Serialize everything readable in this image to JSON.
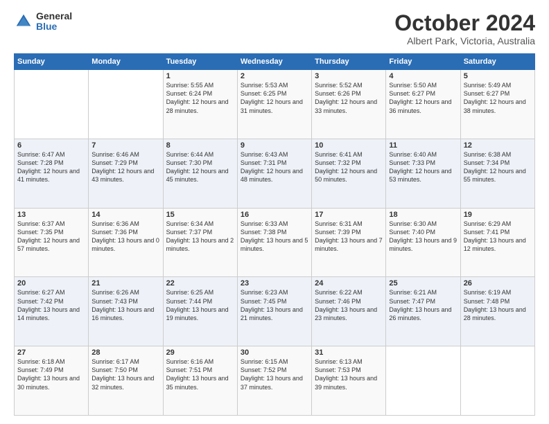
{
  "logo": {
    "general": "General",
    "blue": "Blue"
  },
  "title": "October 2024",
  "subtitle": "Albert Park, Victoria, Australia",
  "days_header": [
    "Sunday",
    "Monday",
    "Tuesday",
    "Wednesday",
    "Thursday",
    "Friday",
    "Saturday"
  ],
  "weeks": [
    [
      {
        "day": "",
        "sunrise": "",
        "sunset": "",
        "daylight": ""
      },
      {
        "day": "",
        "sunrise": "",
        "sunset": "",
        "daylight": ""
      },
      {
        "day": "1",
        "sunrise": "Sunrise: 5:55 AM",
        "sunset": "Sunset: 6:24 PM",
        "daylight": "Daylight: 12 hours and 28 minutes."
      },
      {
        "day": "2",
        "sunrise": "Sunrise: 5:53 AM",
        "sunset": "Sunset: 6:25 PM",
        "daylight": "Daylight: 12 hours and 31 minutes."
      },
      {
        "day": "3",
        "sunrise": "Sunrise: 5:52 AM",
        "sunset": "Sunset: 6:26 PM",
        "daylight": "Daylight: 12 hours and 33 minutes."
      },
      {
        "day": "4",
        "sunrise": "Sunrise: 5:50 AM",
        "sunset": "Sunset: 6:27 PM",
        "daylight": "Daylight: 12 hours and 36 minutes."
      },
      {
        "day": "5",
        "sunrise": "Sunrise: 5:49 AM",
        "sunset": "Sunset: 6:27 PM",
        "daylight": "Daylight: 12 hours and 38 minutes."
      }
    ],
    [
      {
        "day": "6",
        "sunrise": "Sunrise: 6:47 AM",
        "sunset": "Sunset: 7:28 PM",
        "daylight": "Daylight: 12 hours and 41 minutes."
      },
      {
        "day": "7",
        "sunrise": "Sunrise: 6:46 AM",
        "sunset": "Sunset: 7:29 PM",
        "daylight": "Daylight: 12 hours and 43 minutes."
      },
      {
        "day": "8",
        "sunrise": "Sunrise: 6:44 AM",
        "sunset": "Sunset: 7:30 PM",
        "daylight": "Daylight: 12 hours and 45 minutes."
      },
      {
        "day": "9",
        "sunrise": "Sunrise: 6:43 AM",
        "sunset": "Sunset: 7:31 PM",
        "daylight": "Daylight: 12 hours and 48 minutes."
      },
      {
        "day": "10",
        "sunrise": "Sunrise: 6:41 AM",
        "sunset": "Sunset: 7:32 PM",
        "daylight": "Daylight: 12 hours and 50 minutes."
      },
      {
        "day": "11",
        "sunrise": "Sunrise: 6:40 AM",
        "sunset": "Sunset: 7:33 PM",
        "daylight": "Daylight: 12 hours and 53 minutes."
      },
      {
        "day": "12",
        "sunrise": "Sunrise: 6:38 AM",
        "sunset": "Sunset: 7:34 PM",
        "daylight": "Daylight: 12 hours and 55 minutes."
      }
    ],
    [
      {
        "day": "13",
        "sunrise": "Sunrise: 6:37 AM",
        "sunset": "Sunset: 7:35 PM",
        "daylight": "Daylight: 12 hours and 57 minutes."
      },
      {
        "day": "14",
        "sunrise": "Sunrise: 6:36 AM",
        "sunset": "Sunset: 7:36 PM",
        "daylight": "Daylight: 13 hours and 0 minutes."
      },
      {
        "day": "15",
        "sunrise": "Sunrise: 6:34 AM",
        "sunset": "Sunset: 7:37 PM",
        "daylight": "Daylight: 13 hours and 2 minutes."
      },
      {
        "day": "16",
        "sunrise": "Sunrise: 6:33 AM",
        "sunset": "Sunset: 7:38 PM",
        "daylight": "Daylight: 13 hours and 5 minutes."
      },
      {
        "day": "17",
        "sunrise": "Sunrise: 6:31 AM",
        "sunset": "Sunset: 7:39 PM",
        "daylight": "Daylight: 13 hours and 7 minutes."
      },
      {
        "day": "18",
        "sunrise": "Sunrise: 6:30 AM",
        "sunset": "Sunset: 7:40 PM",
        "daylight": "Daylight: 13 hours and 9 minutes."
      },
      {
        "day": "19",
        "sunrise": "Sunrise: 6:29 AM",
        "sunset": "Sunset: 7:41 PM",
        "daylight": "Daylight: 13 hours and 12 minutes."
      }
    ],
    [
      {
        "day": "20",
        "sunrise": "Sunrise: 6:27 AM",
        "sunset": "Sunset: 7:42 PM",
        "daylight": "Daylight: 13 hours and 14 minutes."
      },
      {
        "day": "21",
        "sunrise": "Sunrise: 6:26 AM",
        "sunset": "Sunset: 7:43 PM",
        "daylight": "Daylight: 13 hours and 16 minutes."
      },
      {
        "day": "22",
        "sunrise": "Sunrise: 6:25 AM",
        "sunset": "Sunset: 7:44 PM",
        "daylight": "Daylight: 13 hours and 19 minutes."
      },
      {
        "day": "23",
        "sunrise": "Sunrise: 6:23 AM",
        "sunset": "Sunset: 7:45 PM",
        "daylight": "Daylight: 13 hours and 21 minutes."
      },
      {
        "day": "24",
        "sunrise": "Sunrise: 6:22 AM",
        "sunset": "Sunset: 7:46 PM",
        "daylight": "Daylight: 13 hours and 23 minutes."
      },
      {
        "day": "25",
        "sunrise": "Sunrise: 6:21 AM",
        "sunset": "Sunset: 7:47 PM",
        "daylight": "Daylight: 13 hours and 26 minutes."
      },
      {
        "day": "26",
        "sunrise": "Sunrise: 6:19 AM",
        "sunset": "Sunset: 7:48 PM",
        "daylight": "Daylight: 13 hours and 28 minutes."
      }
    ],
    [
      {
        "day": "27",
        "sunrise": "Sunrise: 6:18 AM",
        "sunset": "Sunset: 7:49 PM",
        "daylight": "Daylight: 13 hours and 30 minutes."
      },
      {
        "day": "28",
        "sunrise": "Sunrise: 6:17 AM",
        "sunset": "Sunset: 7:50 PM",
        "daylight": "Daylight: 13 hours and 32 minutes."
      },
      {
        "day": "29",
        "sunrise": "Sunrise: 6:16 AM",
        "sunset": "Sunset: 7:51 PM",
        "daylight": "Daylight: 13 hours and 35 minutes."
      },
      {
        "day": "30",
        "sunrise": "Sunrise: 6:15 AM",
        "sunset": "Sunset: 7:52 PM",
        "daylight": "Daylight: 13 hours and 37 minutes."
      },
      {
        "day": "31",
        "sunrise": "Sunrise: 6:13 AM",
        "sunset": "Sunset: 7:53 PM",
        "daylight": "Daylight: 13 hours and 39 minutes."
      },
      {
        "day": "",
        "sunrise": "",
        "sunset": "",
        "daylight": ""
      },
      {
        "day": "",
        "sunrise": "",
        "sunset": "",
        "daylight": ""
      }
    ]
  ]
}
